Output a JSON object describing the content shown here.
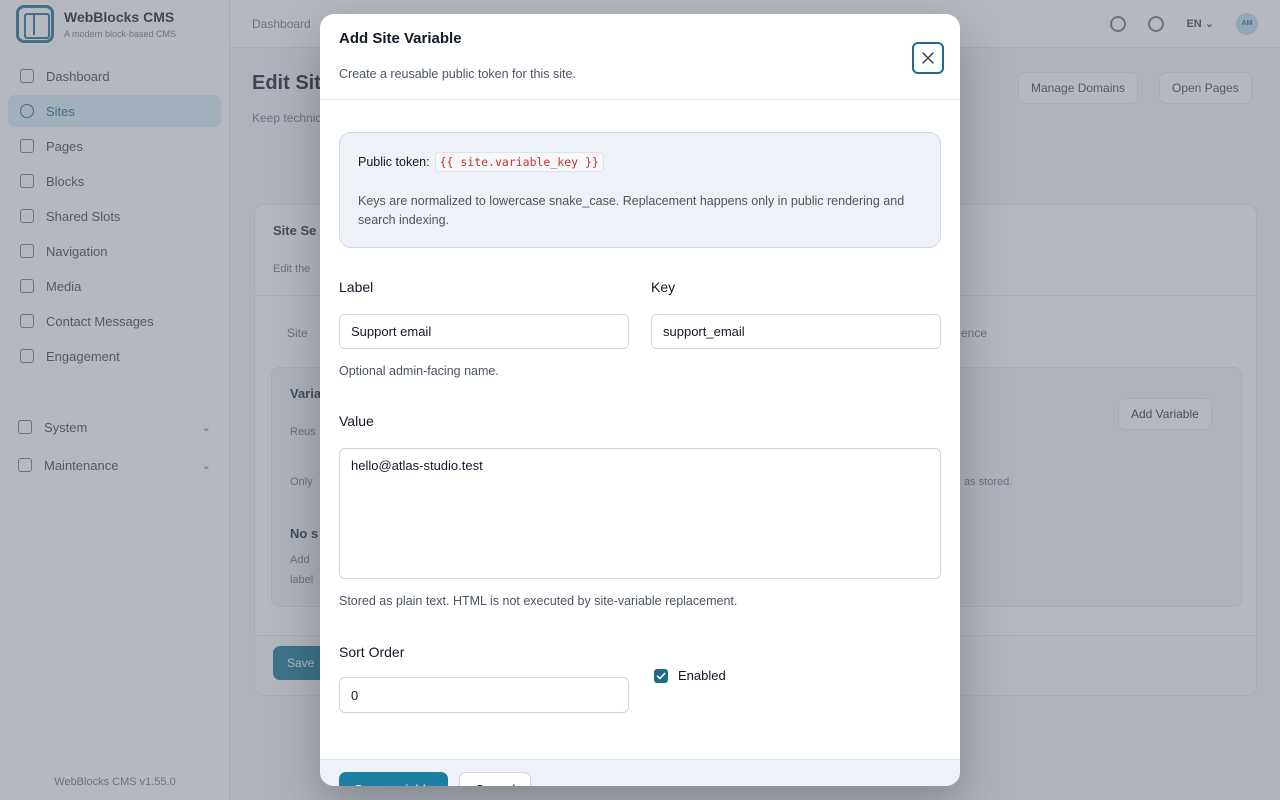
{
  "app": {
    "name": "WebBlocks CMS",
    "tagline": "A modern block-based CMS",
    "version": "WebBlocks CMS v1.55.0"
  },
  "sidebar": {
    "items": [
      {
        "label": "Dashboard",
        "icon": "grid-icon"
      },
      {
        "label": "Sites",
        "icon": "globe-icon"
      },
      {
        "label": "Pages",
        "icon": "document-icon"
      },
      {
        "label": "Blocks",
        "icon": "cube-icon"
      },
      {
        "label": "Shared Slots",
        "icon": "stack-icon"
      },
      {
        "label": "Navigation",
        "icon": "menu-icon"
      },
      {
        "label": "Media",
        "icon": "image-icon"
      },
      {
        "label": "Contact Messages",
        "icon": "mail-icon"
      },
      {
        "label": "Engagement",
        "icon": "star-icon"
      }
    ],
    "groups": [
      {
        "label": "System",
        "icon": "cog-icon"
      },
      {
        "label": "Maintenance",
        "icon": "file-icon"
      }
    ],
    "active": "Sites"
  },
  "topbar": {
    "breadcrumb": "Dashboard",
    "language": "EN",
    "avatar_initials": "AM"
  },
  "page": {
    "title": "Edit Site",
    "description": "Keep technical ... public content ...",
    "buttons": {
      "manage_domains": "Manage Domains",
      "open_pages": "Open Pages"
    },
    "card_title": "Site Se",
    "card_sub": "Edit the",
    "tab_site": "Site",
    "tab_ence": "ence",
    "section_title": "Varia",
    "section_sub": "Reus",
    "add_variable": "Add Variable",
    "only_text": "Only",
    "stored_text": "as stored.",
    "empty_title": "No s",
    "empty_text_1": "Add",
    "empty_text_2": "label",
    "save_button": "Save"
  },
  "modal": {
    "title": "Add Site Variable",
    "subtitle": "Create a reusable public token for this site.",
    "info": {
      "token_label": "Public token:",
      "token_code": "{{ site.variable_key }}",
      "text": "Keys are normalized to lowercase snake_case. Replacement happens only in public rendering and search indexing."
    },
    "fields": {
      "label": {
        "label": "Label",
        "value": "Support email",
        "hint": "Optional admin-facing name."
      },
      "key": {
        "label": "Key",
        "value": "support_email"
      },
      "value": {
        "label": "Value",
        "value": "hello@atlas-studio.test",
        "hint": "Stored as plain text. HTML is not executed by site-variable replacement."
      },
      "sort_order": {
        "label": "Sort Order",
        "value": "0"
      },
      "enabled": {
        "label": "Enabled",
        "checked": true
      }
    },
    "footer": {
      "primary": "Save variable",
      "secondary": "Cancel"
    }
  },
  "colors": {
    "accent": "#1b7fa3",
    "brand": "#1b6e8a",
    "info_bg": "#eef1f8",
    "code_text": "#c0392b"
  }
}
